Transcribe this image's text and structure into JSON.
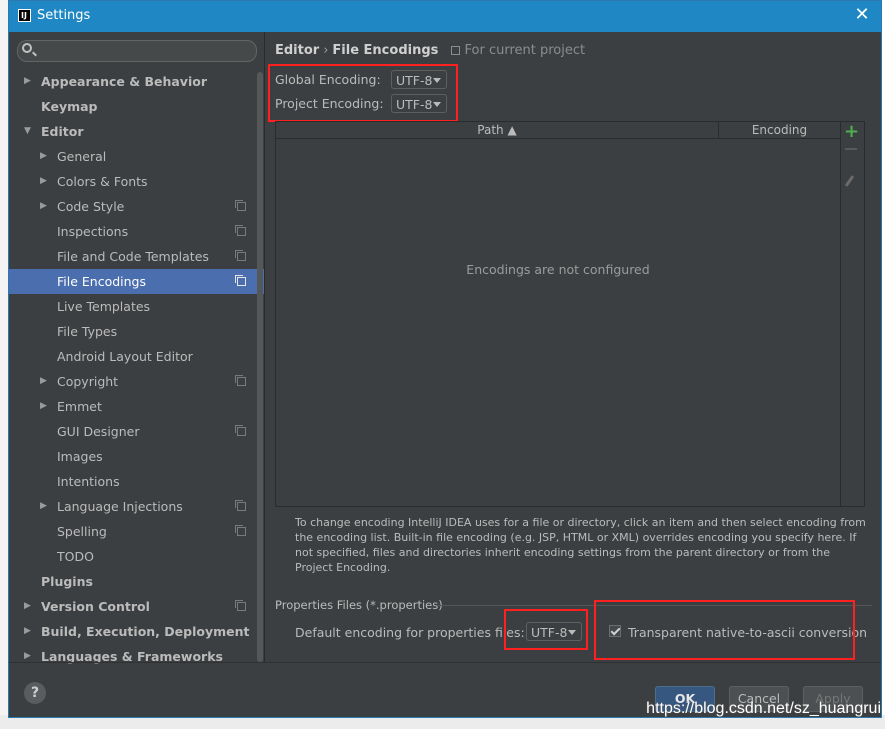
{
  "window": {
    "title": "Settings",
    "app_icon_text": "IJ"
  },
  "sidebar": {
    "search_placeholder": "",
    "items": [
      {
        "label": "Appearance & Behavior",
        "level": 0,
        "expander": "collapsed",
        "bold": true,
        "copy": false
      },
      {
        "label": "Keymap",
        "level": 0,
        "expander": "none",
        "bold": true,
        "copy": false
      },
      {
        "label": "Editor",
        "level": 0,
        "expander": "expanded",
        "bold": true,
        "copy": false
      },
      {
        "label": "General",
        "level": 1,
        "expander": "collapsed",
        "bold": false,
        "copy": false
      },
      {
        "label": "Colors & Fonts",
        "level": 1,
        "expander": "collapsed",
        "bold": false,
        "copy": false
      },
      {
        "label": "Code Style",
        "level": 1,
        "expander": "collapsed",
        "bold": false,
        "copy": true
      },
      {
        "label": "Inspections",
        "level": 1,
        "expander": "none",
        "bold": false,
        "copy": true
      },
      {
        "label": "File and Code Templates",
        "level": 1,
        "expander": "none",
        "bold": false,
        "copy": true
      },
      {
        "label": "File Encodings",
        "level": 1,
        "expander": "none",
        "bold": false,
        "copy": true,
        "selected": true
      },
      {
        "label": "Live Templates",
        "level": 1,
        "expander": "none",
        "bold": false,
        "copy": false
      },
      {
        "label": "File Types",
        "level": 1,
        "expander": "none",
        "bold": false,
        "copy": false
      },
      {
        "label": "Android Layout Editor",
        "level": 1,
        "expander": "none",
        "bold": false,
        "copy": false
      },
      {
        "label": "Copyright",
        "level": 1,
        "expander": "collapsed",
        "bold": false,
        "copy": true
      },
      {
        "label": "Emmet",
        "level": 1,
        "expander": "collapsed",
        "bold": false,
        "copy": false
      },
      {
        "label": "GUI Designer",
        "level": 1,
        "expander": "none",
        "bold": false,
        "copy": true
      },
      {
        "label": "Images",
        "level": 1,
        "expander": "none",
        "bold": false,
        "copy": false
      },
      {
        "label": "Intentions",
        "level": 1,
        "expander": "none",
        "bold": false,
        "copy": false
      },
      {
        "label": "Language Injections",
        "level": 1,
        "expander": "collapsed",
        "bold": false,
        "copy": true
      },
      {
        "label": "Spelling",
        "level": 1,
        "expander": "none",
        "bold": false,
        "copy": true
      },
      {
        "label": "TODO",
        "level": 1,
        "expander": "none",
        "bold": false,
        "copy": false
      },
      {
        "label": "Plugins",
        "level": 0,
        "expander": "none",
        "bold": true,
        "copy": false
      },
      {
        "label": "Version Control",
        "level": 0,
        "expander": "collapsed",
        "bold": true,
        "copy": true
      },
      {
        "label": "Build, Execution, Deployment",
        "level": 0,
        "expander": "collapsed",
        "bold": true,
        "copy": false
      },
      {
        "label": "Languages & Frameworks",
        "level": 0,
        "expander": "collapsed",
        "bold": true,
        "copy": false
      }
    ]
  },
  "breadcrumb": {
    "parent": "Editor",
    "separator": "›",
    "current": "File Encodings",
    "scope": "For current project"
  },
  "encodings": {
    "global_label": "Global Encoding:",
    "global_value": "UTF-8",
    "project_label": "Project Encoding:",
    "project_value": "UTF-8"
  },
  "table": {
    "columns": [
      "Path ▲",
      "Encoding"
    ],
    "empty_message": "Encodings are not configured",
    "toolbar": [
      "add-icon",
      "remove-icon",
      "edit-icon"
    ]
  },
  "help_text": "To change encoding IntelliJ IDEA uses for a file or directory, click an item and then select encoding from the encoding list. Built-in file encoding (e.g. JSP, HTML or XML) overrides encoding you specify here. If not specified, files and directories inherit encoding settings from the parent directory or from the Project Encoding.",
  "properties": {
    "section_title": "Properties Files (*.properties)",
    "default_label": "Default encoding for properties files:",
    "default_value": "UTF-8",
    "native_to_ascii_label": "Transparent native-to-ascii conversion",
    "native_to_ascii_checked": true
  },
  "buttons": {
    "help": "?",
    "ok": "OK",
    "cancel": "Cancel",
    "apply": "Apply"
  },
  "watermark": "https://blog.csdn.net/sz_huangrui",
  "colors": {
    "titlebar": "#1f87c4",
    "panel": "#3c3f41",
    "selection": "#4b6eaf",
    "highlight_box": "#ff2020",
    "add_icon": "#4fae4e"
  }
}
